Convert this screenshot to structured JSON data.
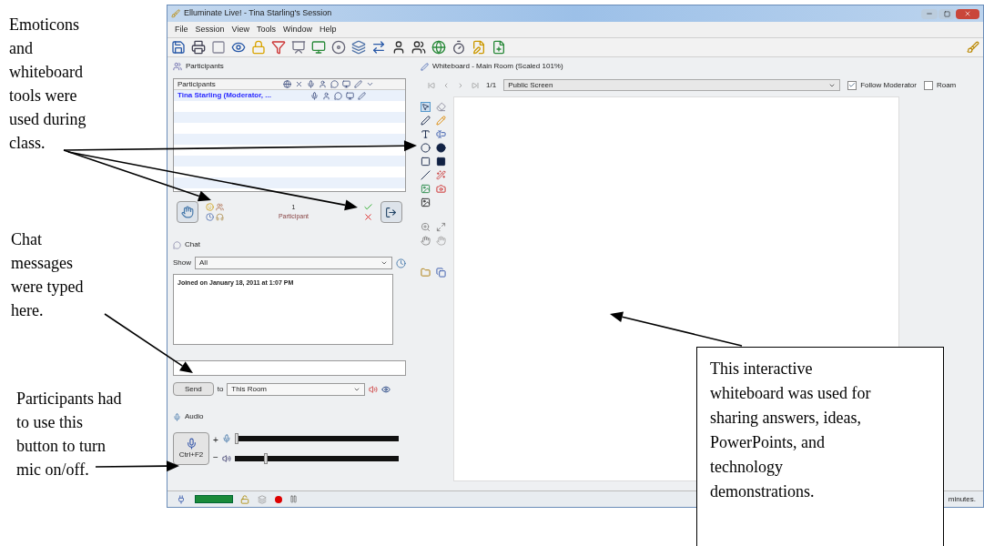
{
  "window": {
    "title": "Elluminate Live! - Tina Starling's Session"
  },
  "menu": [
    "File",
    "Session",
    "View",
    "Tools",
    "Window",
    "Help"
  ],
  "participants": {
    "title": "Participants",
    "column": "Participants",
    "rows": [
      {
        "name": "Tina Starling (Moderator, ..."
      }
    ],
    "count": "1",
    "count_label": "Participant"
  },
  "chat": {
    "title": "Chat",
    "show_label": "Show",
    "show_value": "All",
    "messages": [
      "Joined on January 18, 2011 at 1:07 PM"
    ],
    "send": "Send",
    "to_label": "to",
    "to_value": "This Room"
  },
  "audio": {
    "title": "Audio",
    "mic_button": "Ctrl+F2",
    "plus": "+",
    "minus": "−",
    "sliders": [
      {
        "kind": "mic",
        "level": 0
      },
      {
        "kind": "speaker",
        "level": 0.18
      }
    ]
  },
  "whiteboard": {
    "title": "Whiteboard - Main Room (Scaled 101%)",
    "page": "1/1",
    "screen": "Public Screen",
    "follow_moderator": {
      "label": "Follow Moderator",
      "checked": true
    },
    "roam": {
      "label": "Roam",
      "checked": false
    }
  },
  "status_bar": {
    "text": "minutes."
  },
  "annotations": [
    {
      "text": "Emoticons and whiteboard tools were used during class."
    },
    {
      "text": "Chat messages were typed here."
    },
    {
      "text": "Participants had to use this button to turn mic on/off."
    },
    {
      "text": "This interactive whiteboard was used for sharing answers, ideas, PowerPoints, and technology demonstrations."
    }
  ]
}
